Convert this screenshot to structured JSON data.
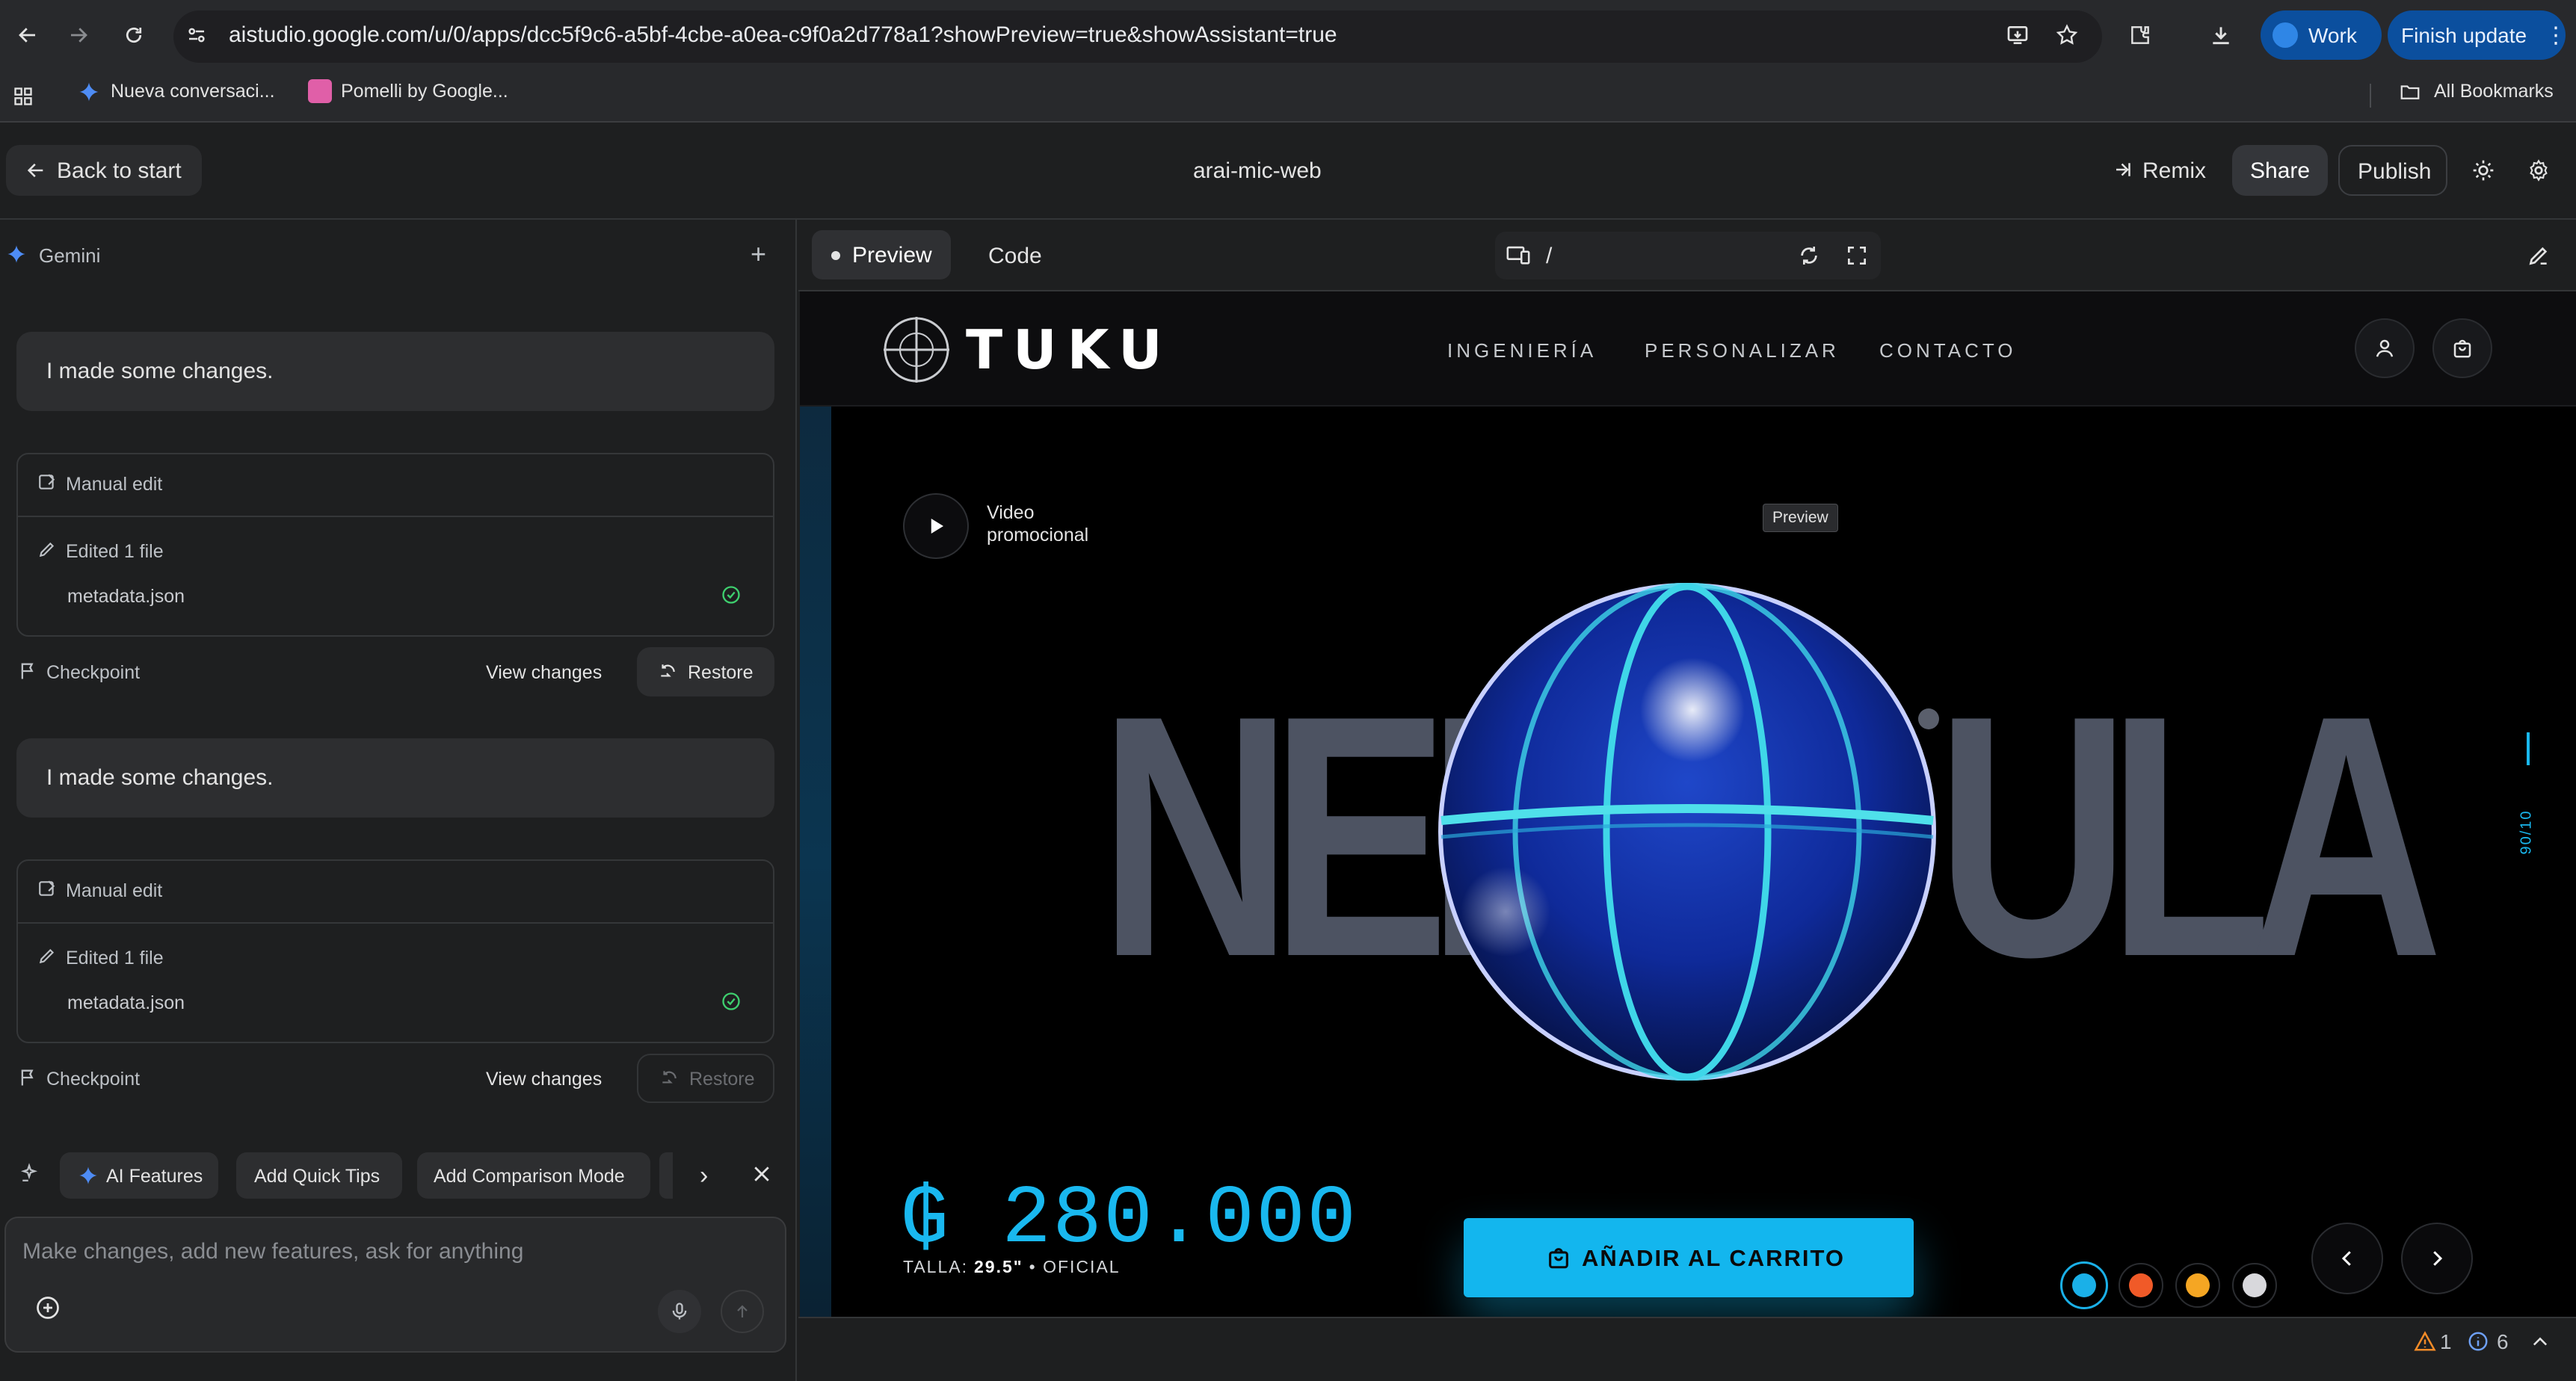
{
  "browser": {
    "url": "aistudio.google.com/u/0/apps/dcc5f9c6-a5bf-4cbe-a0ea-c9f0a2d778a1?showPreview=true&showAssistant=true",
    "profile_label": "Work",
    "update_label": "Finish update",
    "bookmarks": [
      "Nueva conversaci...",
      "Pomelli by Google..."
    ],
    "all_bookmarks_label": "All Bookmarks"
  },
  "header": {
    "back_label": "Back to start",
    "project_title": "arai-mic-web",
    "remix_label": "Remix",
    "share_label": "Share",
    "publish_label": "Publish"
  },
  "chat": {
    "title": "Gemini",
    "messages": [
      {
        "text": "I made some changes.",
        "edit_type": "Manual edit",
        "edited_label": "Edited 1 file",
        "file": "metadata.json",
        "checkpoint_label": "Checkpoint",
        "view_changes_label": "View changes",
        "restore_label": "Restore"
      },
      {
        "text": "I made some changes.",
        "edit_type": "Manual edit",
        "edited_label": "Edited 1 file",
        "file": "metadata.json",
        "checkpoint_label": "Checkpoint",
        "view_changes_label": "View changes",
        "restore_label": "Restore"
      }
    ],
    "suggestions": [
      "AI Features",
      "Add Quick Tips",
      "Add Comparison Mode"
    ],
    "input_placeholder": "Make changes, add new features, ask for anything"
  },
  "preview_toolbar": {
    "tabs": [
      "Preview",
      "Code"
    ],
    "route": "/"
  },
  "site": {
    "brand": "TUKU",
    "nav": [
      "INGENIERÍA",
      "PERSONALIZAR",
      "CONTACTO"
    ],
    "video_label_line1": "Video",
    "video_label_line2": "promocional",
    "preview_badge": "Preview",
    "word_left": "NEB",
    "word_right": "ULA",
    "progress_label": "90/10",
    "price": "₲ 280.000",
    "size_label": "TALLA:",
    "size_value": "29.5\"",
    "size_suffix": "• OFICIAL",
    "cart_label": "AÑADIR AL CARRITO",
    "color_options": [
      "#1ab0e8",
      "#f05a28",
      "#f5a623",
      "#d8d8dc"
    ]
  },
  "status": {
    "warnings": "1",
    "infos": "6"
  },
  "colors": {
    "accent": "#13b6ee",
    "chrome_blue": "#0b4f9e",
    "success": "#3ecf6e"
  }
}
